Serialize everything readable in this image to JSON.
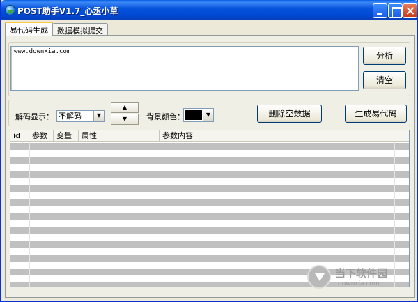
{
  "window": {
    "title": "POST助手V1.7_心丞小草"
  },
  "tabs": [
    {
      "label": "易代码生成"
    },
    {
      "label": "数据模拟提交"
    }
  ],
  "input": {
    "url_value": "www.downxia.com"
  },
  "buttons": {
    "analyze": "分析",
    "clear": "清空",
    "delete_empty": "删除空数据",
    "generate": "生成易代码"
  },
  "controls": {
    "decode_label": "解码显示：",
    "decode_value": "不解码",
    "bg_color_label": "背景颜色：",
    "bg_color_value": "#000000"
  },
  "table": {
    "columns": [
      "id",
      "参数",
      "变量",
      "属性",
      "参数内容"
    ]
  },
  "watermark": {
    "text": "当下软件园",
    "sub": "downxia.com"
  }
}
